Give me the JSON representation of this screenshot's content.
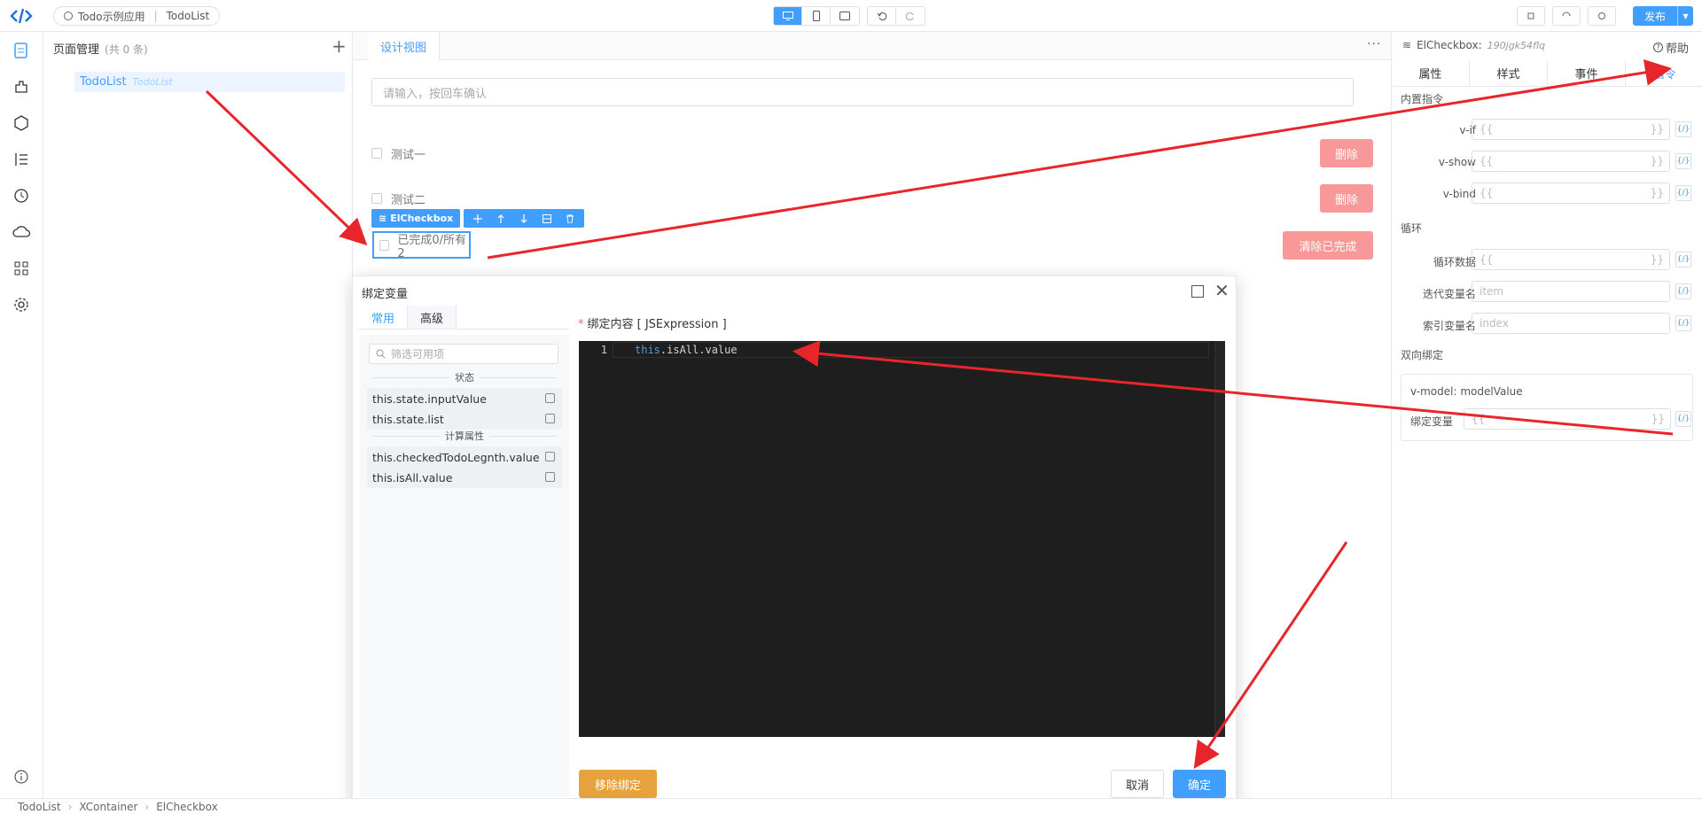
{
  "topbar": {
    "app_name": "Todo示例应用",
    "page_name": "TodoList",
    "publish_label": "发布"
  },
  "page_panel": {
    "title": "页面管理",
    "count": "(共 0 条)",
    "items": [
      {
        "name": "TodoList",
        "route": "TodoList"
      }
    ]
  },
  "canvas": {
    "tab_label": "设计视图",
    "input_placeholder": "请输入，按回车确认",
    "todos": [
      {
        "text": "测试一",
        "button": "删除"
      },
      {
        "text": "测试二",
        "button": "删除"
      }
    ],
    "selected_component": "ElCheckbox",
    "footer_checkbox_text": "已完成0/所有2",
    "clear_button": "清除已完成"
  },
  "right_panel": {
    "component": "ElCheckbox:",
    "component_id": "190jgk54flq",
    "help": "帮助",
    "tabs": [
      "属性",
      "样式",
      "事件",
      "指令"
    ],
    "active_tab": "指令",
    "sections": {
      "builtin": "内置指令",
      "loop": "循环",
      "two_way": "双向绑定"
    },
    "builtin_rows": [
      "v-if",
      "v-show",
      "v-bind"
    ],
    "loop_rows": [
      {
        "label": "循环数据",
        "value": "{{",
        "placeholder": ""
      },
      {
        "label": "迭代变量名",
        "value": "",
        "placeholder": "item"
      },
      {
        "label": "索引变量名",
        "value": "",
        "placeholder": "index"
      }
    ],
    "vmodel_label": "v-model: modelValue",
    "bind_var_label": "绑定变量",
    "expr_open": "{{",
    "expr_close": "}}",
    "fx": "{/}"
  },
  "dialog": {
    "title": "绑定变量",
    "tabs": [
      "常用",
      "高级"
    ],
    "active_tab": "常用",
    "search_placeholder": "筛选可用项",
    "groups": [
      {
        "name": "状态",
        "items": [
          "this.state.inputValue",
          "this.state.list"
        ]
      },
      {
        "name": "计算属性",
        "items": [
          "this.checkedTodoLegnth.value",
          "this.isAll.value"
        ]
      }
    ],
    "content_label": "绑定内容 [ JSExpression ]",
    "editor": {
      "line": "1",
      "keyword": "this",
      "rest": ".isAll.value"
    },
    "buttons": {
      "unbind": "移除绑定",
      "cancel": "取消",
      "ok": "确定"
    }
  },
  "statusbar": {
    "path": [
      "TodoList",
      "XContainer",
      "ElCheckbox"
    ]
  },
  "colors": {
    "accent": "#409eff",
    "danger_light": "#f89898",
    "warning": "#e6a23c",
    "annotation_arrow": "#e8252b"
  }
}
